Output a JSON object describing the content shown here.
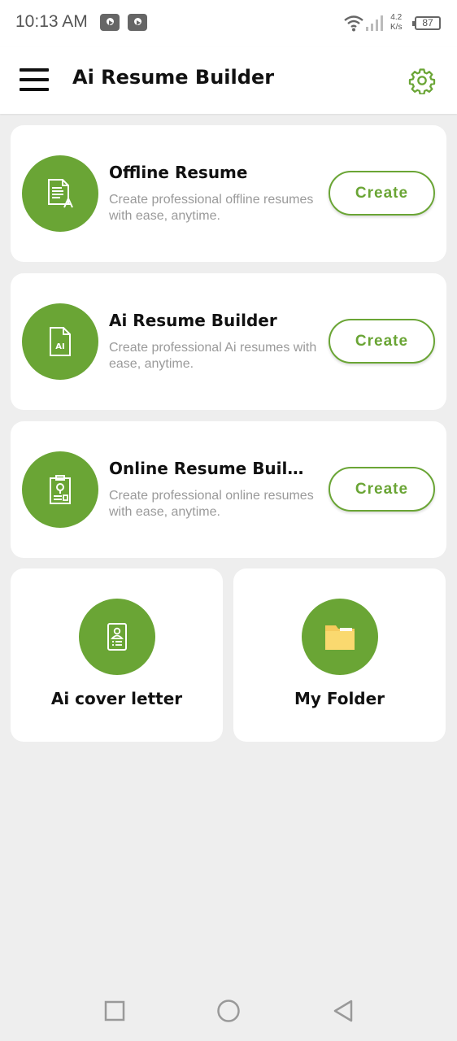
{
  "status_bar": {
    "time": "10:13 AM",
    "notification_icons": [
      "youtube-icon",
      "youtube-icon"
    ],
    "speed_value": "4.2",
    "speed_unit": "K/s",
    "battery": "87"
  },
  "app_bar": {
    "title": "Ai Resume Builder",
    "menu_icon": "hamburger-menu-icon",
    "settings_icon": "gear-icon"
  },
  "cards": [
    {
      "title": "Offline Resume",
      "description": "Create professional offline resumes with ease, anytime.",
      "button": "Create",
      "icon": "document-icon"
    },
    {
      "title": "Ai Resume Builder",
      "description": "Create professional Ai resumes with ease, anytime.",
      "button": "Create",
      "icon": "ai-document-icon"
    },
    {
      "title": "Online Resume Builder",
      "description": "Create professional online resumes with ease, anytime.",
      "button": "Create",
      "icon": "clipboard-icon"
    }
  ],
  "tiles": [
    {
      "label": "Ai cover letter",
      "icon": "cover-letter-icon"
    },
    {
      "label": "My Folder",
      "icon": "folder-icon"
    }
  ],
  "colors": {
    "accent": "#6aa535",
    "background": "#eeeeee",
    "card": "#ffffff",
    "description_text": "#9a9a9a",
    "folder": "#f5cb5c"
  },
  "nav_bar": [
    "recents-icon",
    "home-icon",
    "back-icon"
  ]
}
